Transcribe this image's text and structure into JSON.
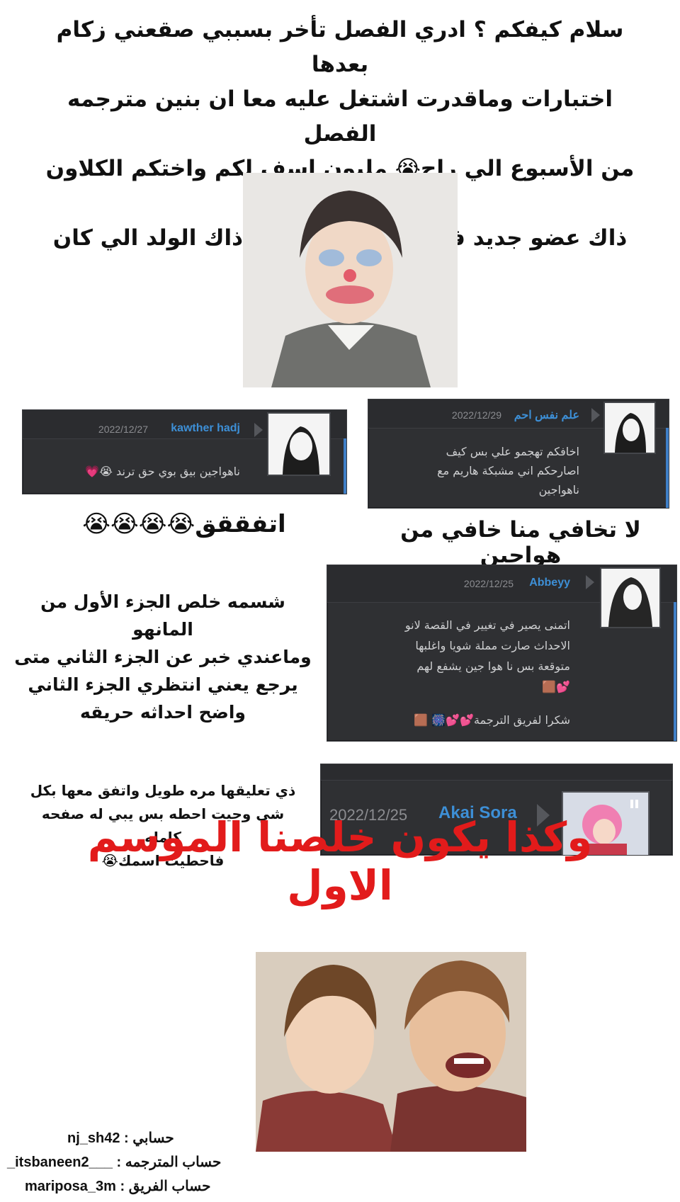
{
  "intro": {
    "lines": [
      "سلام كيفكم ؟ ادري الفصل تأخر بسببي صقعني زكام بعدها",
      "اختبارات وماقدرت اشتغل عليه معا ان بنين مترجمه الفصل",
      "من الأسبوع الي راح😭 مليون اسف لكم واختكم الكلاون حسبت",
      "ذاك عضو جديد في الجمعيه طلع ابو ذاك الولد الي كان يتعنف"
    ]
  },
  "comments": [
    {
      "name": "kawther hadj",
      "date": "2022/12/27",
      "text": "ناهواجين بيق بوي   حق ترند 😭💗"
    },
    {
      "name": "علم نفس احم",
      "date": "2022/12/29",
      "lines": [
        "اخافكم تهجمو علي بس كيف",
        "اصارحكم اني مشبكة هاريم مع",
        "ناهواجين"
      ]
    },
    {
      "name": "Abbeyy",
      "date": "2022/12/25",
      "lines": [
        "اتمنى يصير في تغيير في القصة لانو",
        "الاحداث صارت مملة شويا واغلبها",
        "متوقعة بس نا هوا جين يشفع لهم",
        "💕🟫"
      ],
      "footer": "شكرا لفريق الترجمة💕💕🎆 🟫"
    },
    {
      "name": "Akai Sora",
      "date": "2022/12/25"
    }
  ],
  "notes": {
    "n1": "اتفققق😭😭😭😭",
    "n2": "لا تخافي منا خافي من هواجين",
    "n3": [
      "شسمه خلص الجزء الأول من المانهو",
      "وماعندي خبر عن الجزء الثاني متى",
      "يرجع يعني انتظري الجزء الثاني",
      "واضح احداثه حريقه"
    ],
    "n4": [
      "ذي تعليقها مره طويل واتفق معها بكل",
      "شي وحيت احطه بس يبي له صفحه كامله",
      "فاحطيت اسمك😭"
    ]
  },
  "headline": "وكذا يكون خلصنا الموسم الاول",
  "credits": [
    {
      "label": "حسابي :",
      "value": "nj_sh42"
    },
    {
      "label": "حساب المترجمه :",
      "value": "_itsbaneen2___"
    },
    {
      "label": "حساب الفريق :",
      "value": "mariposa_3m"
    }
  ],
  "colors": {
    "card_bg": "#2f3033",
    "name_blue": "#3d8fd6",
    "headline_red": "#e21b1b"
  }
}
